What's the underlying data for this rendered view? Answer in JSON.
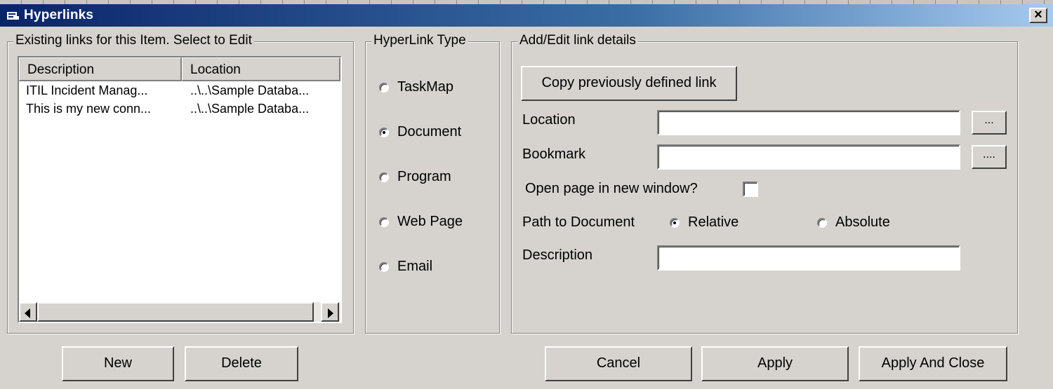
{
  "window": {
    "title": "Hyperlinks",
    "close_label": "×"
  },
  "links_group": {
    "legend": "Existing links for this Item. Select to Edit",
    "columns": [
      "Description",
      "Location"
    ],
    "rows": [
      {
        "description": "ITIL Incident Manag...",
        "location": "..\\..\\Sample Databa..."
      },
      {
        "description": "This is my new conn...",
        "location": "..\\..\\Sample Databa..."
      }
    ]
  },
  "type_group": {
    "legend": "HyperLink Type",
    "options": [
      "TaskMap",
      "Document",
      "Program",
      "Web Page",
      "Email"
    ],
    "selected": "Document"
  },
  "details_group": {
    "legend": "Add/Edit link details",
    "copy_button": "Copy previously defined link",
    "location_label": "Location",
    "location_value": "",
    "bookmark_label": "Bookmark",
    "bookmark_value": "",
    "browse_location": "...",
    "browse_bookmark": "....",
    "new_window_label": "Open page in new window?",
    "new_window_checked": false,
    "path_label": "Path to Document",
    "path_options": [
      "Relative",
      "Absolute"
    ],
    "path_selected": "Relative",
    "description_label": "Description",
    "description_value": ""
  },
  "buttons": {
    "new": "New",
    "delete": "Delete",
    "cancel": "Cancel",
    "apply": "Apply",
    "apply_close": "Apply And Close"
  }
}
